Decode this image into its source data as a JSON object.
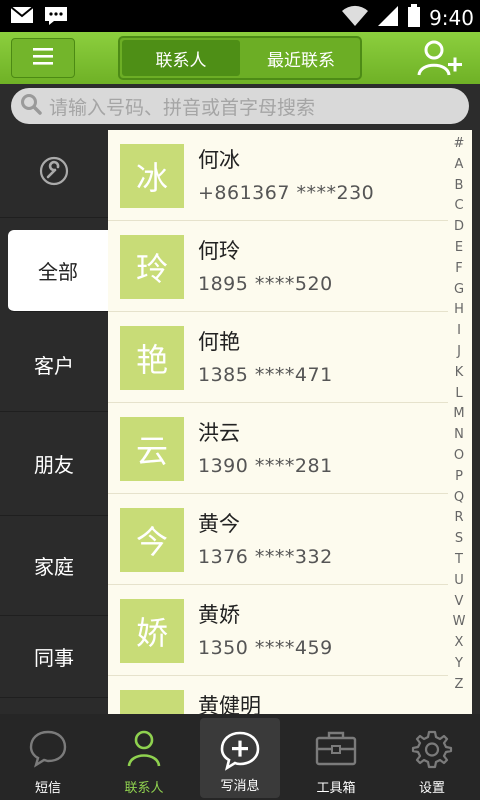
{
  "status_bar": {
    "time": "9:40"
  },
  "header": {
    "tabs": [
      {
        "label": "联系人",
        "active": true
      },
      {
        "label": "最近联系",
        "active": false
      }
    ]
  },
  "search": {
    "placeholder": "请输入号码、拼音或首字母搜索"
  },
  "sidebar": {
    "items": [
      {
        "label": "",
        "icon": "wrench-icon"
      },
      {
        "label": "全部",
        "active": true
      },
      {
        "label": "客户"
      },
      {
        "label": "朋友"
      },
      {
        "label": "家庭"
      },
      {
        "label": "同事"
      }
    ]
  },
  "contacts": [
    {
      "avatar": "冰",
      "name": "何冰",
      "phone": "+861367 ****230"
    },
    {
      "avatar": "玲",
      "name": "何玲",
      "phone": "1895 ****520"
    },
    {
      "avatar": "艳",
      "name": "何艳",
      "phone": "1385 ****471"
    },
    {
      "avatar": "云",
      "name": "洪云",
      "phone": "1390 ****281"
    },
    {
      "avatar": "今",
      "name": "黄今",
      "phone": "1376 ****332"
    },
    {
      "avatar": "娇",
      "name": "黄娇",
      "phone": "1350 ****459"
    },
    {
      "avatar": "",
      "name": "黄健明",
      "phone": ""
    }
  ],
  "alphabet": [
    "#",
    "A",
    "B",
    "C",
    "D",
    "E",
    "F",
    "G",
    "H",
    "I",
    "J",
    "K",
    "L",
    "M",
    "N",
    "O",
    "P",
    "Q",
    "R",
    "S",
    "T",
    "U",
    "V",
    "W",
    "X",
    "Y",
    "Z"
  ],
  "bottom_nav": [
    {
      "label": "短信",
      "icon": "chat-bubble-icon"
    },
    {
      "label": "联系人",
      "icon": "person-icon",
      "active": true
    },
    {
      "label": "写消息",
      "icon": "compose-icon"
    },
    {
      "label": "工具箱",
      "icon": "toolbox-icon"
    },
    {
      "label": "设置",
      "icon": "gear-icon"
    }
  ],
  "colors": {
    "accent": "#7cc034",
    "avatar_bg": "#c8dc77",
    "list_bg": "#fdfbee",
    "active_nav": "#8fd14f"
  }
}
